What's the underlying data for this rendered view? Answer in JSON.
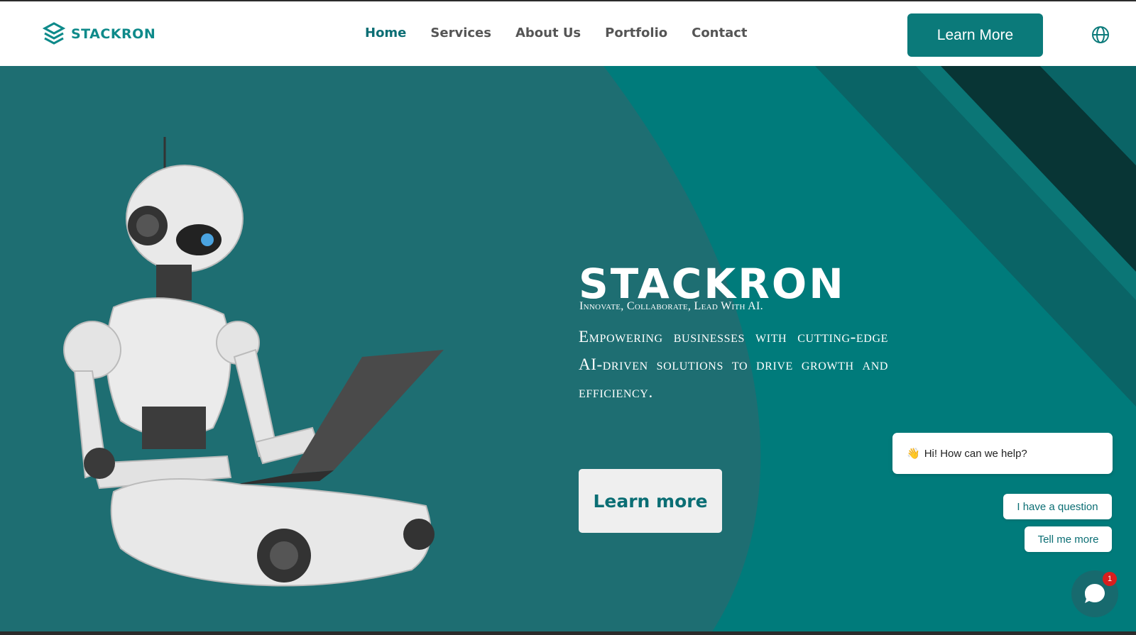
{
  "header": {
    "logo_text": "STACKRON",
    "nav": [
      {
        "label": "Home",
        "active": true
      },
      {
        "label": "Services",
        "active": false
      },
      {
        "label": "About Us",
        "active": false
      },
      {
        "label": "Portfolio",
        "active": false
      },
      {
        "label": "Contact",
        "active": false
      }
    ],
    "cta_label": "Learn More",
    "language_icon": "globe-icon"
  },
  "hero": {
    "brand": "STACKRON",
    "tagline": "Innovate, Collaborate, Lead With AI.",
    "description": "Empowering businesses with cutting-edge AI-driven solutions to drive growth and efficiency.",
    "cta_label": "Learn more"
  },
  "chat": {
    "greeting_emoji": "👋",
    "greeting": "Hi! How can we help?",
    "options": [
      "I have a question",
      "Tell me more"
    ],
    "unread_count": "1"
  },
  "colors": {
    "primary": "#0b7a7a",
    "hero_bg": "#1e6e72",
    "hero_shape": "#007b7b",
    "stripe_dark": "#083535",
    "stripe_mid": "#0a5e60"
  }
}
